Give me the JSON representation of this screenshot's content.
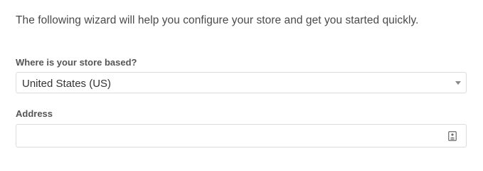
{
  "intro": {
    "text": "The following wizard will help you configure your store and get you started quickly."
  },
  "country_field": {
    "label": "Where is your store based?",
    "value": "United States (US)",
    "arrow_icon": "chevron-down-icon"
  },
  "address_field": {
    "label": "Address",
    "value": "",
    "placeholder": "",
    "autofill_icon": "contact-card-icon"
  }
}
